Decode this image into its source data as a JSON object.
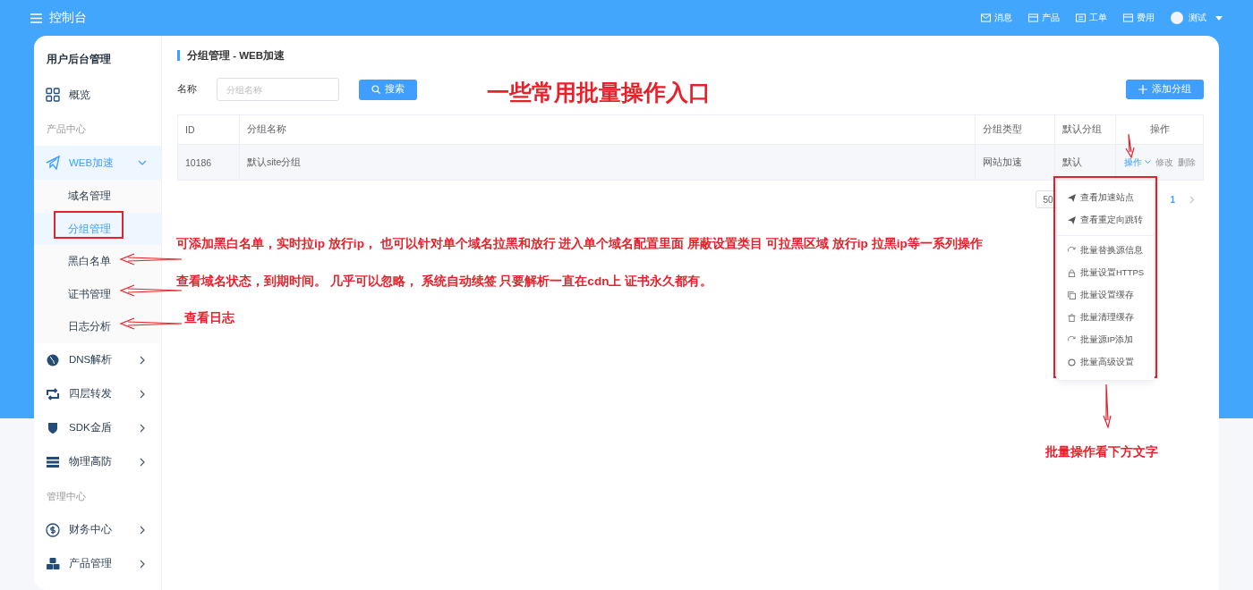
{
  "topbar": {
    "title": "控制台",
    "nav": [
      {
        "label": "消息"
      },
      {
        "label": "产品"
      },
      {
        "label": "工单"
      },
      {
        "label": "费用"
      }
    ],
    "user": "测试"
  },
  "sidebar": {
    "title": "用户后台管理",
    "items": [
      {
        "kind": "item",
        "label": "概览",
        "selected": false
      },
      {
        "kind": "heading",
        "label": "产品中心"
      },
      {
        "kind": "item",
        "label": "WEB加速",
        "selected": true,
        "expanded": true,
        "children": [
          {
            "label": "域名管理",
            "selected": false
          },
          {
            "label": "分组管理",
            "selected": true
          },
          {
            "label": "黑白名单",
            "selected": false
          },
          {
            "label": "证书管理",
            "selected": false
          },
          {
            "label": "日志分析",
            "selected": false
          }
        ]
      },
      {
        "kind": "item",
        "label": "DNS解析",
        "selected": false,
        "expanded": false
      },
      {
        "kind": "item",
        "label": "四层转发",
        "selected": false,
        "expanded": false
      },
      {
        "kind": "item",
        "label": "SDK金盾",
        "selected": false,
        "expanded": false
      },
      {
        "kind": "item",
        "label": "物理高防",
        "selected": false,
        "expanded": false
      },
      {
        "kind": "heading",
        "label": "管理中心"
      },
      {
        "kind": "item",
        "label": "财务中心",
        "selected": false,
        "expanded": false
      },
      {
        "kind": "item",
        "label": "产品管理",
        "selected": false,
        "expanded": false
      }
    ]
  },
  "page": {
    "title": "分组管理 - WEB加速",
    "filter_label": "名称",
    "search": {
      "placeholder": "分组名称"
    },
    "search_button": "搜索",
    "add_button": "添加分组"
  },
  "table": {
    "columns": [
      "ID",
      "分组名称",
      "分组类型",
      "默认分组",
      "操作"
    ],
    "rows": [
      {
        "cells": [
          "10186",
          "默认site分组",
          "网站加速",
          "默认"
        ],
        "actions": [
          {
            "label": "操作",
            "disabled": false
          },
          {
            "label": "修改",
            "disabled": true
          },
          {
            "label": "删除",
            "disabled": true
          }
        ]
      }
    ]
  },
  "pagination": {
    "page_size": "50",
    "pages": [
      {
        "label": "1",
        "selected": true
      }
    ]
  },
  "action_menu": {
    "groups": [
      [
        "查看加速站点",
        "查看重定向跳转"
      ],
      [
        "批量替换源信息",
        "批量设置HTTPS",
        "批量设置缓存",
        "批量清理缓存",
        "批量源IP添加",
        "批量高级设置"
      ]
    ]
  },
  "annotations": {
    "headline": "一些常用批量操作入口",
    "notes": [
      "可添加黑白名单，实时拉ip 放行ip， 也可以针对单个域名拉黑和放行 进入单个域名配置里面 屏蔽设置类目 可拉黑区域 放行ip 拉黑ip等一系列操作",
      "查看域名状态，到期时间。 几乎可以忽略， 系统自动续签 只要解析一直在cdn上 证书永久都有。",
      "查看日志"
    ],
    "menu_hint": "批量操作看下方文字"
  }
}
